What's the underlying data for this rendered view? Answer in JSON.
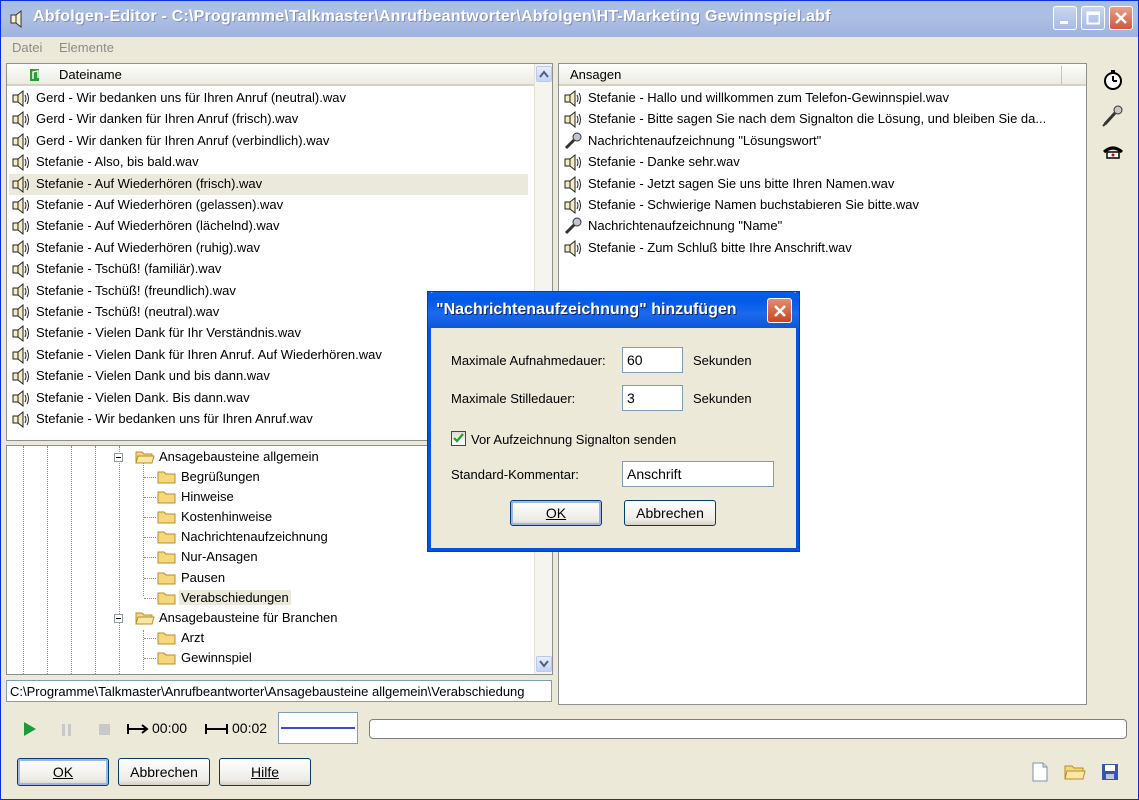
{
  "window": {
    "title": "Abfolgen-Editor - C:\\Programme\\Talkmaster\\Anrufbeantworter\\Abfolgen\\HT-Marketing Gewinnspiel.abf"
  },
  "menu": [
    "Datei",
    "Elemente"
  ],
  "files_panel": {
    "header": "Dateiname",
    "items": [
      "Gerd - Wir bedanken uns für Ihren Anruf (neutral).wav",
      "Gerd - Wir danken für Ihren Anruf (frisch).wav",
      "Gerd - Wir danken für Ihren Anruf (verbindlich).wav",
      "Stefanie - Also, bis bald.wav",
      "Stefanie - Auf Wiederhören (frisch).wav",
      "Stefanie - Auf Wiederhören (gelassen).wav",
      "Stefanie - Auf Wiederhören (lächelnd).wav",
      "Stefanie - Auf Wiederhören (ruhig).wav",
      "Stefanie - Tschüß! (familiär).wav",
      "Stefanie - Tschüß! (freundlich).wav",
      "Stefanie - Tschüß! (neutral).wav",
      "Stefanie - Vielen Dank für Ihr Verständnis.wav",
      "Stefanie - Vielen Dank für Ihren Anruf. Auf Wiederhören.wav",
      "Stefanie - Vielen Dank und bis dann.wav",
      "Stefanie - Vielen Dank. Bis dann.wav",
      "Stefanie - Wir bedanken uns für Ihren Anruf.wav"
    ],
    "selected_index": 4
  },
  "tree": {
    "group1": "Ansagebausteine allgemein",
    "group1_children": [
      "Begrüßungen",
      "Hinweise",
      "Kostenhinweise",
      "Nachrichtenaufzeichnung",
      "Nur-Ansagen",
      "Pausen",
      "Verabschiedungen"
    ],
    "group2": "Ansagebausteine für Branchen",
    "group2_children": [
      "Arzt",
      "Gewinnspiel"
    ]
  },
  "path": "C:\\Programme\\Talkmaster\\Anrufbeantworter\\Ansagebausteine allgemein\\Verabschiedung",
  "announcements_panel": {
    "header": "Ansagen",
    "items": [
      {
        "type": "speaker",
        "label": "Stefanie - Hallo und willkommen zum Telefon-Gewinnspiel.wav"
      },
      {
        "type": "speaker",
        "label": "Stefanie - Bitte sagen Sie nach dem Signalton die Lösung, und bleiben Sie da..."
      },
      {
        "type": "mic",
        "label": "Nachrichtenaufzeichnung \"Lösungswort\""
      },
      {
        "type": "speaker",
        "label": "Stefanie - Danke sehr.wav"
      },
      {
        "type": "speaker",
        "label": "Stefanie - Jetzt sagen Sie uns bitte Ihren Namen.wav"
      },
      {
        "type": "speaker",
        "label": "Stefanie - Schwierige Namen buchstabieren Sie bitte.wav"
      },
      {
        "type": "mic",
        "label": "Nachrichtenaufzeichnung \"Name\""
      },
      {
        "type": "speaker",
        "label": "Stefanie - Zum Schluß bitte Ihre Anschrift.wav"
      }
    ]
  },
  "player": {
    "start_time": "00:00",
    "end_time": "00:02"
  },
  "buttons": {
    "ok": "OK",
    "cancel": "Abbrechen",
    "help": "Hilfe"
  },
  "dialog": {
    "title": "\"Nachrichtenaufzeichnung\" hinzufügen",
    "max_record_label": "Maximale Aufnahmedauer:",
    "max_record_value": "60",
    "max_silence_label": "Maximale Stilledauer:",
    "max_silence_value": "3",
    "unit": "Sekunden",
    "checkbox_label": "Vor Aufzeichnung Signalton senden",
    "checkbox_checked": true,
    "comment_label": "Standard-Kommentar:",
    "comment_value": "Anschrift",
    "ok": "OK",
    "cancel": "Abbrechen"
  },
  "colors": {
    "xp_blue": "#0054e3",
    "window_bg": "#ece9d8",
    "titlebar_inactive": "#a6bde8"
  }
}
